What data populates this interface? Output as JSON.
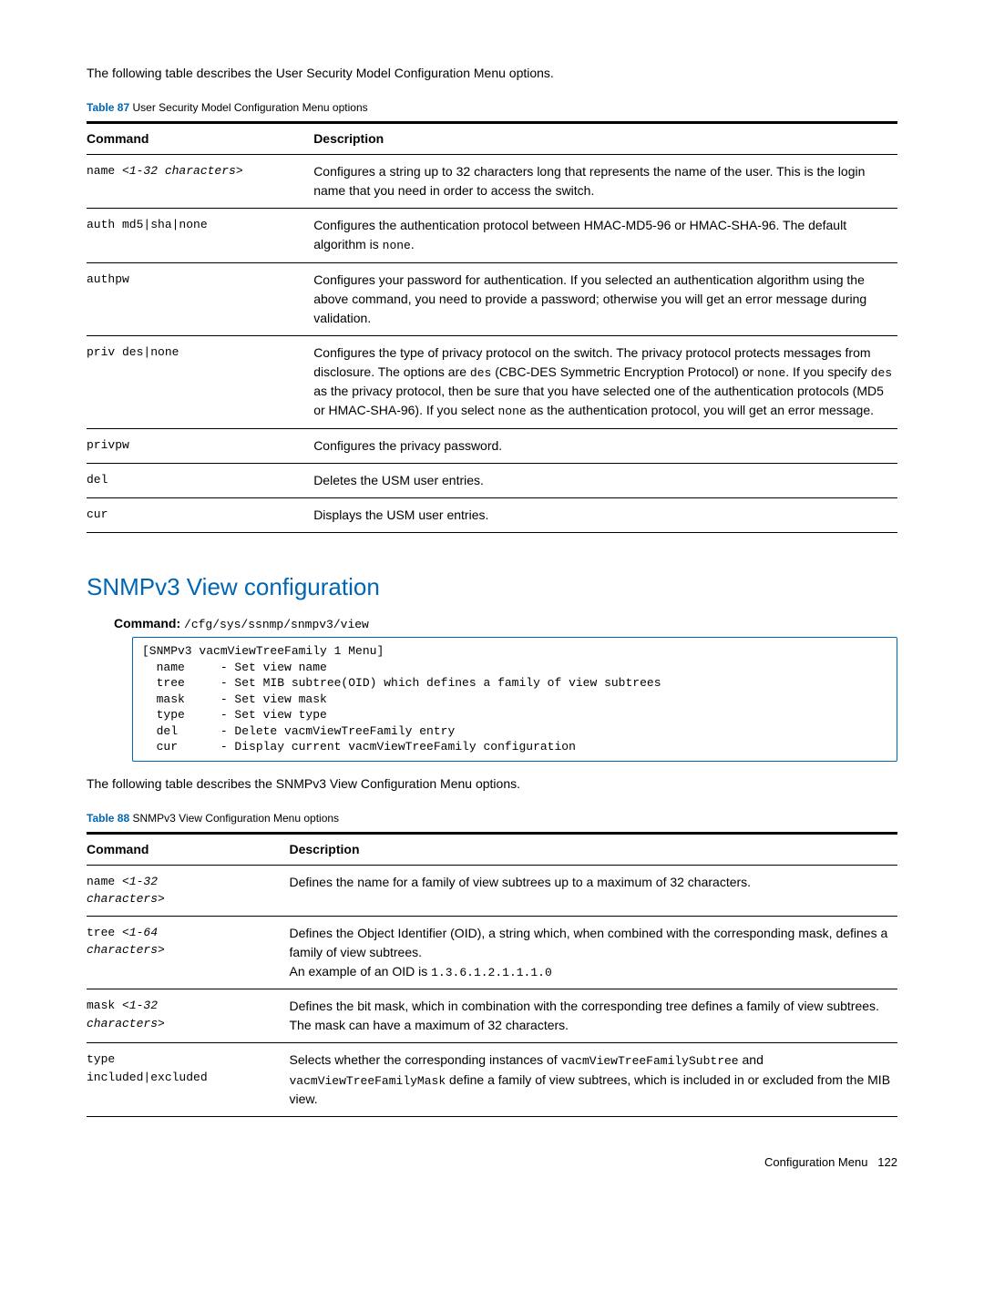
{
  "intro1": "The following table describes the User Security Model Configuration Menu options.",
  "table87": {
    "label": "Table 87",
    "caption": "User Security Model Configuration Menu options",
    "header": {
      "command": "Command",
      "description": "Description"
    },
    "rows": [
      {
        "cmd_html": "name <span class=\"param\">&lt;1-32 characters&gt;</span>",
        "desc_html": "Configures a string up to 32 characters long that represents the name of the user. This is the login name that you need in order to access the switch."
      },
      {
        "cmd_html": "auth md5|sha|none",
        "desc_html": "Configures the authentication protocol between HMAC-MD5-96 or HMAC-SHA-96. The default algorithm is <span class=\"mono-inline\">none</span>."
      },
      {
        "cmd_html": "authpw",
        "desc_html": "Configures your password for authentication. If you selected an authentication algorithm using the above command, you need to provide a password; otherwise you will get an error message during validation."
      },
      {
        "cmd_html": "priv des|none",
        "desc_html": "Configures the type of privacy protocol on the switch. The privacy protocol protects messages from disclosure. The options are <span class=\"mono-inline\">des</span> (CBC-DES Symmetric Encryption Protocol) or <span class=\"mono-inline\">none</span>. If you specify <span class=\"mono-inline\">des</span> as the privacy protocol, then be sure that you have selected one of the authentication protocols (MD5 or HMAC-SHA-96). If you select <span class=\"mono-inline\">none</span> as the authentication protocol, you will get an error message."
      },
      {
        "cmd_html": "privpw",
        "desc_html": "Configures the privacy password."
      },
      {
        "cmd_html": "del",
        "desc_html": "Deletes the USM user entries."
      },
      {
        "cmd_html": "cur",
        "desc_html": "Displays the USM user entries."
      }
    ]
  },
  "section2": {
    "title": "SNMPv3 View configuration",
    "command_label": "Command:",
    "command_path": "/cfg/sys/ssnmp/snmpv3/view",
    "code": "[SNMPv3 vacmViewTreeFamily 1 Menu]\n  name     - Set view name\n  tree     - Set MIB subtree(OID) which defines a family of view subtrees\n  mask     - Set view mask\n  type     - Set view type\n  del      - Delete vacmViewTreeFamily entry\n  cur      - Display current vacmViewTreeFamily configuration"
  },
  "intro2": "The following table describes the SNMPv3 View Configuration Menu options.",
  "table88": {
    "label": "Table 88",
    "caption": "SNMPv3 View Configuration Menu options",
    "header": {
      "command": "Command",
      "description": "Description"
    },
    "rows": [
      {
        "cmd_html": "name <span class=\"param\">&lt;1-32<br>characters&gt;</span>",
        "desc_html": "Defines the name for a family of view subtrees up to a maximum of 32 characters."
      },
      {
        "cmd_html": "tree <span class=\"param\">&lt;1-64<br>characters&gt;</span>",
        "desc_html": "Defines the Object Identifier (OID), a string which, when combined with the corresponding mask, defines a family of view subtrees.<br>An example of an OID is <span class=\"mono-inline\">1.3.6.1.2.1.1.1.0</span>"
      },
      {
        "cmd_html": "mask <span class=\"param\">&lt;1-32<br>characters&gt;</span>",
        "desc_html": "Defines the bit mask, which in combination with the corresponding tree defines a family of view subtrees. The mask can have a maximum of 32 characters."
      },
      {
        "cmd_html": "type<br>included|excluded",
        "desc_html": "Selects whether the corresponding instances of <span class=\"mono-inline\">vacmViewTreeFamilySubtree</span> and <span class=\"mono-inline\">vacmViewTreeFamilyMask</span> define a family of view subtrees, which is included in or excluded from the MIB view."
      }
    ]
  },
  "footer": {
    "label": "Configuration Menu",
    "page": "122"
  }
}
